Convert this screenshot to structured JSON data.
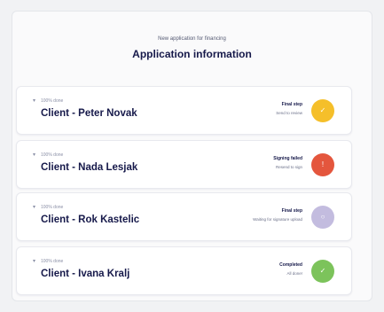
{
  "header": {
    "subtitle": "New application for financing",
    "title": "Application information"
  },
  "cards": [
    {
      "progress": "100% done",
      "client": "Client - Peter Novak",
      "step_title": "Final step",
      "step_sub": "Send to review",
      "status_color": "#f5bf2a",
      "icon_glyph": "✓",
      "icon_name": "check-icon"
    },
    {
      "progress": "100% done",
      "client": "Client - Nada Lesjak",
      "step_title": "Signing failed",
      "step_sub": "Resend to sign",
      "status_color": "#e4563d",
      "icon_glyph": "!",
      "icon_name": "alert-icon"
    },
    {
      "progress": "100% done",
      "client": "Client - Rok Kastelic",
      "step_title": "Final step",
      "step_sub": "Waiting for signature upload",
      "status_color": "#c3bcdf",
      "icon_glyph": "○",
      "icon_name": "pending-icon"
    },
    {
      "progress": "100% done",
      "client": "Client - Ivana Kralj",
      "step_title": "Completed",
      "step_sub": "All done!",
      "status_color": "#7cc35b",
      "icon_glyph": "✓",
      "icon_name": "check-icon"
    }
  ]
}
